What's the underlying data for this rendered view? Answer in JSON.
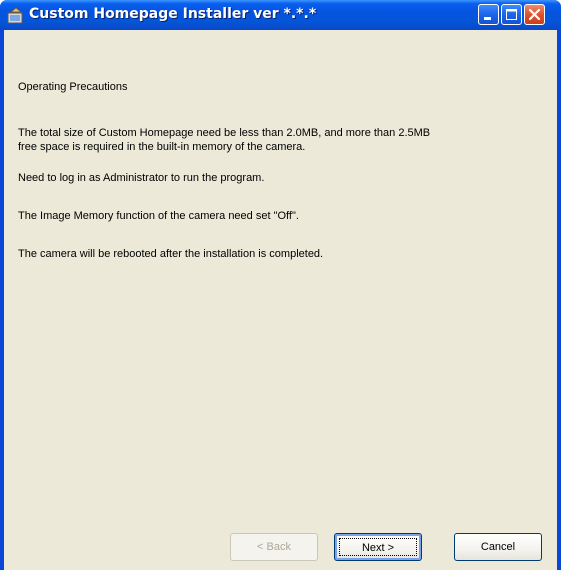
{
  "window": {
    "title": "Custom Homepage Installer ver *.*.*"
  },
  "content": {
    "heading": "Operating Precautions",
    "precaution_1_line_1": "The total size of Custom Homepage need be less than 2.0MB, and more than 2.5MB",
    "precaution_1_line_2": " free space is required in the built-in memory of the camera.",
    "precaution_2": "Need to log in as Administrator to run the program.",
    "precaution_3": "The Image Memory function of the camera need set \"Off\".",
    "precaution_4": "The camera will be rebooted after the installation is completed."
  },
  "buttons": {
    "back_label": "< Back",
    "next_label": "Next >",
    "cancel_label": "Cancel"
  },
  "colors": {
    "titlebar": "#0553e0",
    "client_background": "#ece9d8",
    "close_button": "#e0522c"
  },
  "icons": {
    "app": "installer-app-icon",
    "minimize": "minimize-icon",
    "maximize": "maximize-icon",
    "close": "close-icon"
  }
}
